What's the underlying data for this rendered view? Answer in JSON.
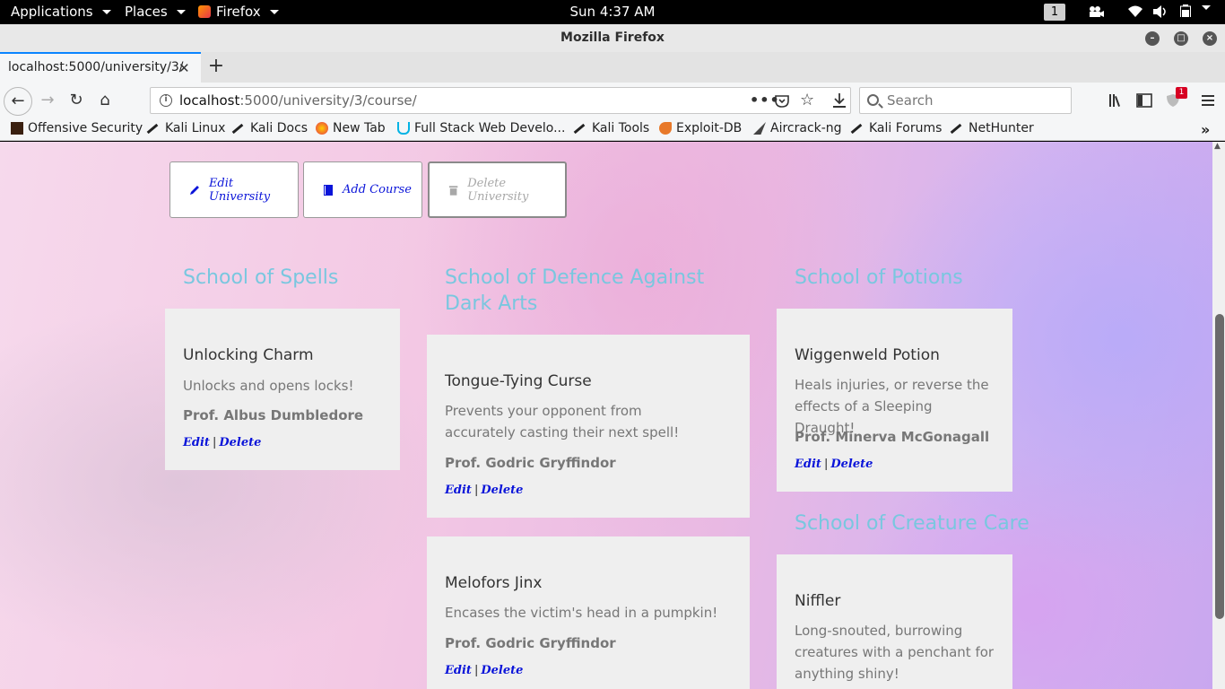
{
  "system_bar": {
    "applications": "Applications",
    "places": "Places",
    "firefox": "Firefox",
    "clock": "Sun  4:37 AM",
    "workspace": "1"
  },
  "window": {
    "title": "Mozilla Firefox"
  },
  "tab": {
    "label": "localhost:5000/university/3/"
  },
  "url": {
    "host": "localhost",
    "path": ":5000/university/3/course/"
  },
  "search": {
    "placeholder": "Search"
  },
  "notifications_badge": "1",
  "bookmarks": [
    "Offensive Security",
    "Kali Linux",
    "Kali Docs",
    "New Tab",
    "Full Stack Web Develo...",
    "Kali Tools",
    "Exploit-DB",
    "Aircrack-ng",
    "Kali Forums",
    "NetHunter"
  ],
  "actions": {
    "edit_university": "Edit University",
    "add_course": "Add Course",
    "delete_university": "Delete University"
  },
  "schools": [
    {
      "title": "School of Spells",
      "courses": [
        {
          "name": "Unlocking Charm",
          "description": "Unlocks and opens locks!",
          "professor": "Prof. Albus Dumbledore"
        }
      ]
    },
    {
      "title": "School of Defence Against Dark Arts",
      "courses": [
        {
          "name": "Tongue-Tying Curse",
          "description": "Prevents your opponent from accurately casting their next spell!",
          "professor": "Prof. Godric Gryffindor"
        },
        {
          "name": "Melofors Jinx",
          "description": "Encases the victim's head in a pumpkin!",
          "professor": "Prof. Godric Gryffindor"
        }
      ]
    },
    {
      "title": "School of Potions",
      "courses": [
        {
          "name": "Wiggenweld Potion",
          "description": "Heals injuries, or reverse the effects of a Sleeping Draught!",
          "professor": "Prof. Minerva McGonagall"
        }
      ]
    },
    {
      "title": "School of Creature Care",
      "courses": [
        {
          "name": "Niffler",
          "description": "Long-snouted, burrowing creatures with a penchant for anything shiny!"
        }
      ]
    }
  ],
  "links": {
    "edit": "Edit",
    "separator": "|",
    "delete": "Delete"
  },
  "colors": {
    "accent_link": "#0a14d9",
    "school_title": "#79c7df",
    "card_bg": "#efefef"
  }
}
